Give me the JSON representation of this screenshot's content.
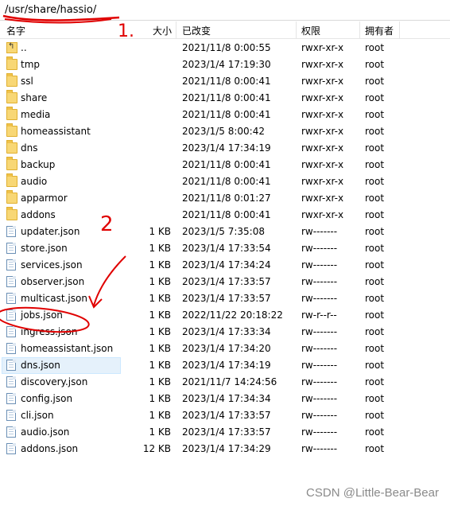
{
  "pathbar": {
    "path": "/usr/share/hassio/"
  },
  "columns": {
    "name": "名字",
    "size": "大小",
    "modified": "已改变",
    "permissions": "权限",
    "owner": "拥有者"
  },
  "rows": [
    {
      "name": "..",
      "size": "",
      "modified": "2021/11/8 0:00:55",
      "permissions": "rwxr-xr-x",
      "owner": "root",
      "icon": "parent-folder-icon"
    },
    {
      "name": "tmp",
      "size": "",
      "modified": "2023/1/4 17:19:30",
      "permissions": "rwxr-xr-x",
      "owner": "root",
      "icon": "folder-icon"
    },
    {
      "name": "ssl",
      "size": "",
      "modified": "2021/11/8 0:00:41",
      "permissions": "rwxr-xr-x",
      "owner": "root",
      "icon": "folder-icon"
    },
    {
      "name": "share",
      "size": "",
      "modified": "2021/11/8 0:00:41",
      "permissions": "rwxr-xr-x",
      "owner": "root",
      "icon": "folder-icon"
    },
    {
      "name": "media",
      "size": "",
      "modified": "2021/11/8 0:00:41",
      "permissions": "rwxr-xr-x",
      "owner": "root",
      "icon": "folder-icon"
    },
    {
      "name": "homeassistant",
      "size": "",
      "modified": "2023/1/5 8:00:42",
      "permissions": "rwxr-xr-x",
      "owner": "root",
      "icon": "folder-icon"
    },
    {
      "name": "dns",
      "size": "",
      "modified": "2023/1/4 17:34:19",
      "permissions": "rwxr-xr-x",
      "owner": "root",
      "icon": "folder-icon"
    },
    {
      "name": "backup",
      "size": "",
      "modified": "2021/11/8 0:00:41",
      "permissions": "rwxr-xr-x",
      "owner": "root",
      "icon": "folder-icon"
    },
    {
      "name": "audio",
      "size": "",
      "modified": "2021/11/8 0:00:41",
      "permissions": "rwxr-xr-x",
      "owner": "root",
      "icon": "folder-icon"
    },
    {
      "name": "apparmor",
      "size": "",
      "modified": "2021/11/8 0:01:27",
      "permissions": "rwxr-xr-x",
      "owner": "root",
      "icon": "folder-icon"
    },
    {
      "name": "addons",
      "size": "",
      "modified": "2021/11/8 0:00:41",
      "permissions": "rwxr-xr-x",
      "owner": "root",
      "icon": "folder-icon"
    },
    {
      "name": "updater.json",
      "size": "1 KB",
      "modified": "2023/1/5 7:35:08",
      "permissions": "rw-------",
      "owner": "root",
      "icon": "file-icon"
    },
    {
      "name": "store.json",
      "size": "1 KB",
      "modified": "2023/1/4 17:33:54",
      "permissions": "rw-------",
      "owner": "root",
      "icon": "file-icon"
    },
    {
      "name": "services.json",
      "size": "1 KB",
      "modified": "2023/1/4 17:34:24",
      "permissions": "rw-------",
      "owner": "root",
      "icon": "file-icon"
    },
    {
      "name": "observer.json",
      "size": "1 KB",
      "modified": "2023/1/4 17:33:57",
      "permissions": "rw-------",
      "owner": "root",
      "icon": "file-icon"
    },
    {
      "name": "multicast.json",
      "size": "1 KB",
      "modified": "2023/1/4 17:33:57",
      "permissions": "rw-------",
      "owner": "root",
      "icon": "file-icon"
    },
    {
      "name": "jobs.json",
      "size": "1 KB",
      "modified": "2022/11/22 20:18:22",
      "permissions": "rw-r--r--",
      "owner": "root",
      "icon": "file-icon"
    },
    {
      "name": "ingress.json",
      "size": "1 KB",
      "modified": "2023/1/4 17:33:34",
      "permissions": "rw-------",
      "owner": "root",
      "icon": "file-icon"
    },
    {
      "name": "homeassistant.json",
      "size": "1 KB",
      "modified": "2023/1/4 17:34:20",
      "permissions": "rw-------",
      "owner": "root",
      "icon": "file-icon"
    },
    {
      "name": "dns.json",
      "size": "1 KB",
      "modified": "2023/1/4 17:34:19",
      "permissions": "rw-------",
      "owner": "root",
      "icon": "file-icon",
      "selected": true
    },
    {
      "name": "discovery.json",
      "size": "1 KB",
      "modified": "2021/11/7 14:24:56",
      "permissions": "rw-------",
      "owner": "root",
      "icon": "file-icon"
    },
    {
      "name": "config.json",
      "size": "1 KB",
      "modified": "2023/1/4 17:34:34",
      "permissions": "rw-------",
      "owner": "root",
      "icon": "file-icon"
    },
    {
      "name": "cli.json",
      "size": "1 KB",
      "modified": "2023/1/4 17:33:57",
      "permissions": "rw-------",
      "owner": "root",
      "icon": "file-icon"
    },
    {
      "name": "audio.json",
      "size": "1 KB",
      "modified": "2023/1/4 17:33:57",
      "permissions": "rw-------",
      "owner": "root",
      "icon": "file-icon"
    },
    {
      "name": "addons.json",
      "size": "12 KB",
      "modified": "2023/1/4 17:34:29",
      "permissions": "rw-------",
      "owner": "root",
      "icon": "file-icon"
    }
  ],
  "annotations": {
    "step1": "1.",
    "step2": "2"
  },
  "watermark": "CSDN @Little-Bear-Bear",
  "colors": {
    "selection": "#e5f1fb",
    "annotation": "#e00000",
    "folder": "#f8d775"
  }
}
